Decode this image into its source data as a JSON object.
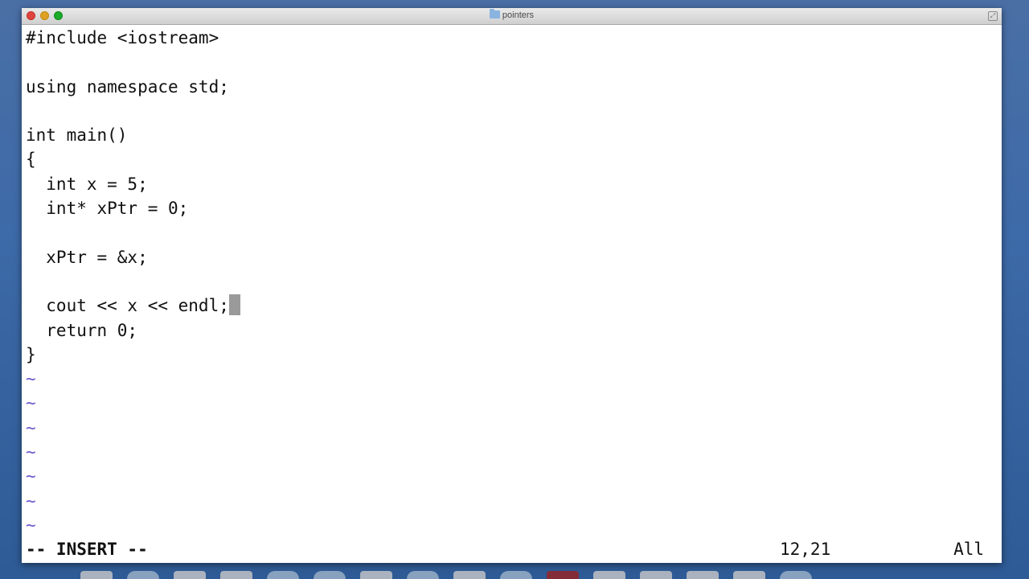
{
  "window": {
    "title": "pointers"
  },
  "editor": {
    "lines": [
      "#include <iostream>",
      "",
      "using namespace std;",
      "",
      "int main()",
      "{",
      "  int x = 5;",
      "  int* xPtr = 0;",
      "",
      "  xPtr = &x;",
      "",
      "  cout << x << endl;",
      "  return 0;",
      "}"
    ],
    "tilde_lines": [
      "~",
      "~",
      "~",
      "~",
      "~",
      "~",
      "~"
    ]
  },
  "statusbar": {
    "mode": "-- INSERT --",
    "position": "12,21",
    "scroll": "All"
  },
  "dock": {
    "icons": [
      "finder-icon",
      "safari-icon",
      "app-icon",
      "app-icon",
      "app-icon",
      "globe-icon",
      "app-icon",
      "app-icon",
      "app-icon",
      "app-icon",
      "app-icon",
      "app-icon",
      "app-icon",
      "app-icon",
      "app-icon",
      "app-icon"
    ]
  }
}
